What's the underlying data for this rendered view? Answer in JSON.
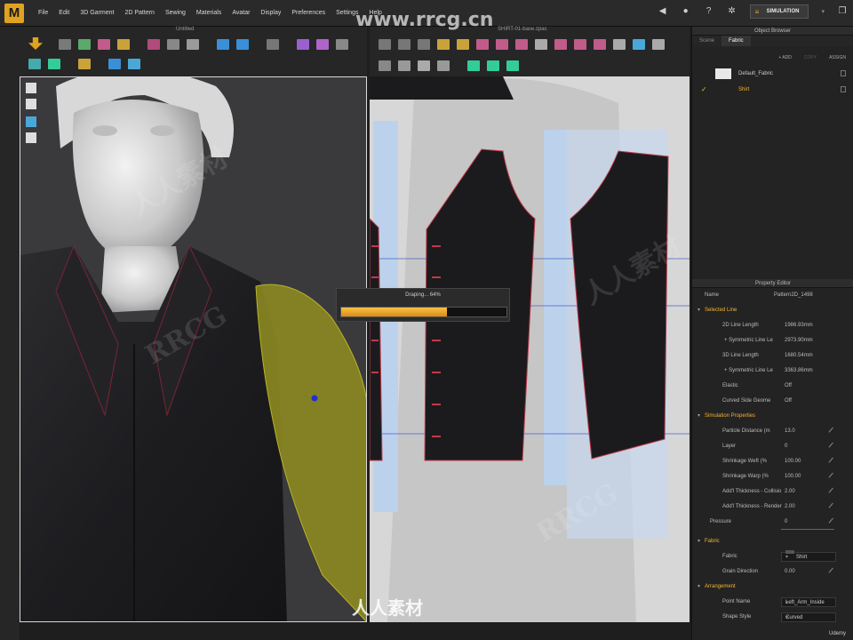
{
  "menu": {
    "logo": "M",
    "items": [
      "File",
      "Edit",
      "3D Garment",
      "2D Pattern",
      "Sewing",
      "Materials",
      "Avatar",
      "Display",
      "Preferences",
      "Settings",
      "Help"
    ],
    "simulation_label": "SIMULATION"
  },
  "views": {
    "view3d_title": "Untitled",
    "view2d_title": "SHIRT-01-base.zpac"
  },
  "progress": {
    "label": "Draping... 64%",
    "fraction": 0.64
  },
  "object_browser": {
    "title": "Object Browser",
    "tabs": [
      "Scene",
      "Fabric"
    ],
    "active_tab": "Fabric",
    "actions": {
      "add": "+ ADD",
      "copy": "COPY",
      "assign": "ASSIGN"
    },
    "items": [
      {
        "label": "Default_Fabric",
        "selected": false
      },
      {
        "label": "Shirt",
        "selected": true
      }
    ]
  },
  "property_editor": {
    "title": "Property Editor",
    "name_label": "Name",
    "name_value": "Pattern2D_1498",
    "selected_line": {
      "header": "Selected Line",
      "rows": [
        {
          "label": "2D Line Length",
          "value": "1986.93mm"
        },
        {
          "label": "+ Symmetric Line Le",
          "value": "2973.90mm"
        },
        {
          "label": "3D Line Length",
          "value": "1680.54mm"
        },
        {
          "label": "+ Symmetric Line Le",
          "value": "3363.86mm"
        },
        {
          "label": "Elastic",
          "value": "Off"
        },
        {
          "label": "Curved Side Geome",
          "value": "Off"
        }
      ]
    },
    "simulation_properties": {
      "header": "Simulation Properties",
      "rows": [
        {
          "label": "Particle Distance (m",
          "value": "13.0"
        },
        {
          "label": "Layer",
          "value": "0"
        },
        {
          "label": "Shrinkage Weft (%",
          "value": "100.00"
        },
        {
          "label": "Shrinkage Warp (%",
          "value": "100.00"
        },
        {
          "label": "Add'l Thickness - Collisio",
          "value": "2.00"
        },
        {
          "label": "Add'l Thickness - Render",
          "value": "2.00"
        },
        {
          "label": "Pressure",
          "value": "0"
        }
      ]
    },
    "fabric": {
      "header": "Fabric",
      "fabric_label": "Fabric",
      "fabric_value": "Shirt",
      "grain_label": "Grain Direction",
      "grain_value": "0.00"
    },
    "arrangement": {
      "header": "Arrangement",
      "point_label": "Point Name",
      "point_value": "Left_Arm_Inside",
      "shape_label": "Shape Style",
      "shape_value": "Curved"
    }
  },
  "watermarks": {
    "url": "www.rrcg.cn",
    "brand": "RRCG",
    "chinese": "人人素材"
  },
  "footer": {
    "udemy": "Udemy"
  },
  "colors": {
    "accent": "#f2b530",
    "sleeve": "#8c8a20",
    "pattern_fill": "#1b1b1d",
    "seam": "#c0394a",
    "highlight_band": "#bcd2ec"
  }
}
